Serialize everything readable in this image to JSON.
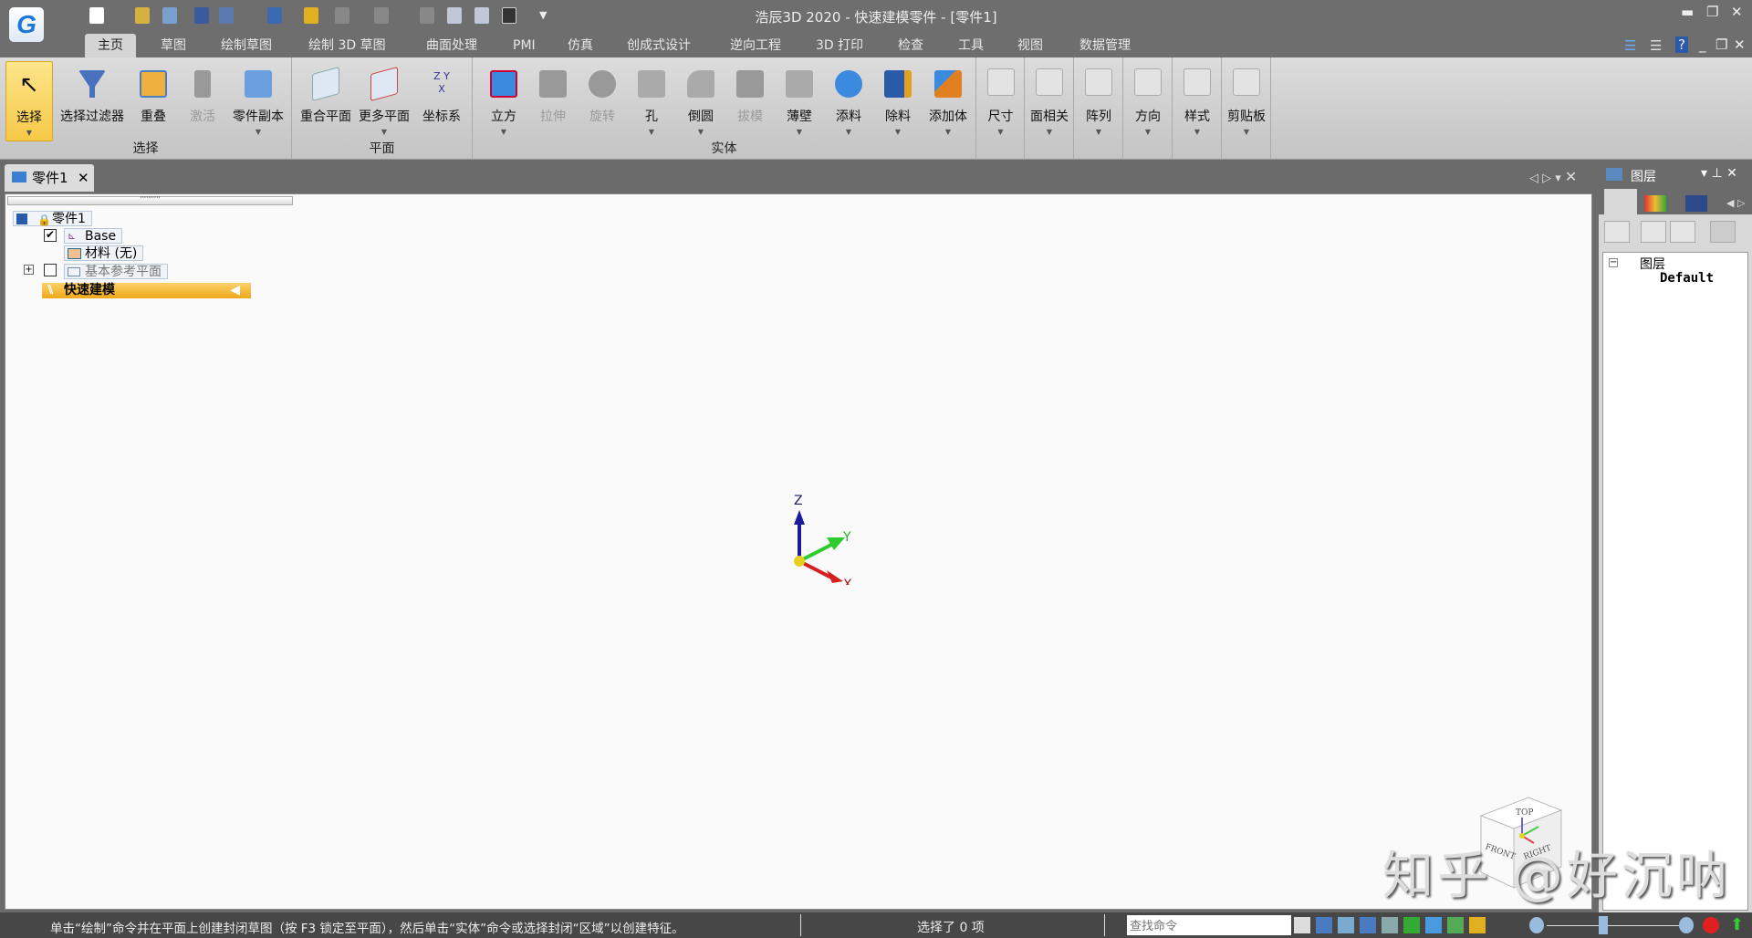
{
  "title": "浩辰3D 2020 - 快速建模零件 - [零件1]",
  "ribbon_tabs": [
    "主页",
    "草图",
    "绘制草图",
    "绘制 3D 草图",
    "曲面处理",
    "PMI",
    "仿真",
    "创成式设计",
    "逆向工程",
    "3D 打印",
    "检查",
    "工具",
    "视图",
    "数据管理"
  ],
  "groups": {
    "select": {
      "label": "选择",
      "buttons": [
        "选择",
        "选择过滤器",
        "重叠",
        "激活",
        "零件副本"
      ]
    },
    "plane": {
      "label": "平面",
      "buttons": [
        "重合平面",
        "更多平面",
        "坐标系"
      ]
    },
    "solid": {
      "label": "实体",
      "buttons": [
        "立方",
        "拉伸",
        "旋转",
        "孔",
        "倒圆",
        "拔模",
        "薄壁",
        "添料",
        "除料",
        "添加体"
      ]
    },
    "small": [
      "尺寸",
      "面相关",
      "阵列",
      "方向",
      "样式",
      "剪贴板"
    ]
  },
  "doc_tab": "零件1",
  "tree": {
    "root": "零件1",
    "base": "Base",
    "material": "材料 (无)",
    "ref_planes": "基本参考平面",
    "quick_model": "快速建模"
  },
  "axes": {
    "z": "Z",
    "y": "Y",
    "x": "X"
  },
  "viewcube": {
    "top": "TOP",
    "front": "FRONT",
    "right": "RIGHT"
  },
  "right_panel": {
    "title": "图层",
    "root": "图层",
    "layer": "Default"
  },
  "status": {
    "hint": "单击“绘制”命令并在平面上创建封闭草图（按 F3 锁定至平面），然后单击“实体”命令或选择封闭“区域”以创建特征。",
    "selection": "选择了 0 项",
    "search_placeholder": "查找命令"
  },
  "watermark": "知乎 @好沉呐",
  "colors": {
    "accent": "#f7c948",
    "x_axis": "#d42020",
    "y_axis": "#2ecc2e",
    "z_axis": "#1a1a9a"
  }
}
